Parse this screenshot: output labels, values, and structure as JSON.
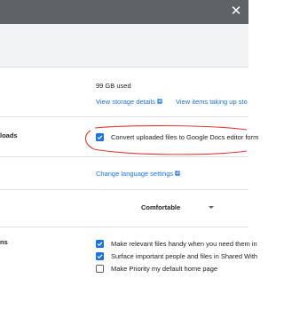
{
  "window": {
    "close_glyph": "✕"
  },
  "storage": {
    "used": "99 GB used",
    "details_link": "View storage details",
    "large_items_link": "View items taking up sto"
  },
  "convert_uploads": {
    "label": "loads",
    "checkbox_label": "Convert uploaded files to Google Docs editor form",
    "checked": true
  },
  "language": {
    "link": "Change language settings"
  },
  "density": {
    "selected": "Comfortable"
  },
  "suggestions": {
    "label": "ns",
    "items": [
      {
        "label": "Make relevant files handy when you need them in",
        "checked": true
      },
      {
        "label": "Surface important people and files in Shared With",
        "checked": true
      },
      {
        "label": "Make Priority my default home page",
        "checked": false
      }
    ]
  },
  "colors": {
    "accent": "#1a73e8",
    "titlebar": "#5f6368",
    "annotation": "#e53935"
  }
}
